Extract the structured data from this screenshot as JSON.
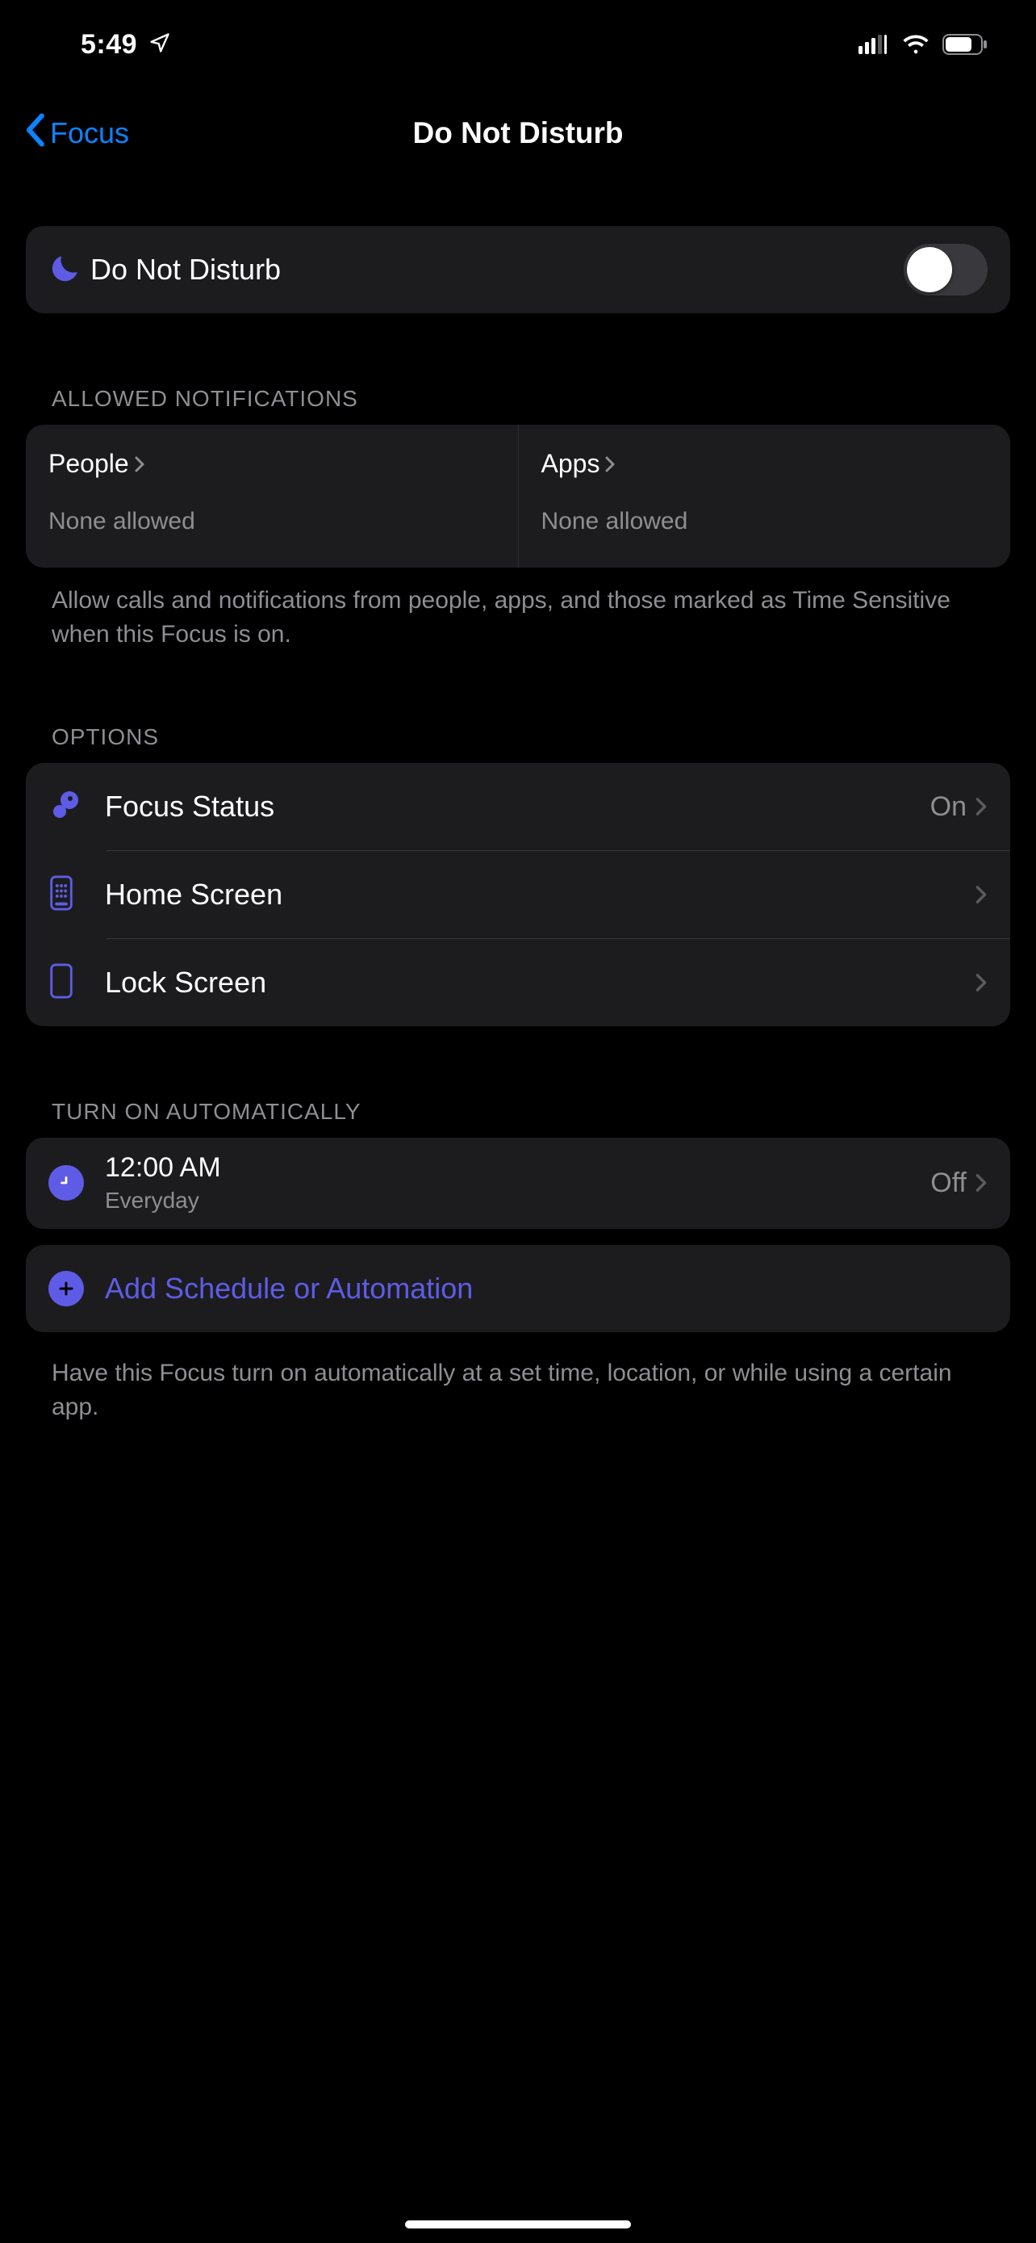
{
  "status": {
    "time": "5:49"
  },
  "nav": {
    "back_label": "Focus",
    "title": "Do Not Disturb"
  },
  "dnd_toggle": {
    "label": "Do Not Disturb"
  },
  "allowed": {
    "header": "ALLOWED NOTIFICATIONS",
    "people_label": "People",
    "people_sub": "None allowed",
    "apps_label": "Apps",
    "apps_sub": "None allowed",
    "footer": "Allow calls and notifications from people, apps, and those marked as Time Sensitive when this Focus is on."
  },
  "options": {
    "header": "OPTIONS",
    "focus_status_label": "Focus Status",
    "focus_status_value": "On",
    "home_screen_label": "Home Screen",
    "lock_screen_label": "Lock Screen"
  },
  "auto": {
    "header": "TURN ON AUTOMATICALLY",
    "schedule_time": "12:00 AM",
    "schedule_repeat": "Everyday",
    "schedule_value": "Off",
    "add_label": "Add Schedule or Automation",
    "footer": "Have this Focus turn on automatically at a set time, location, or while using a certain app."
  },
  "colors": {
    "accent": "#5e5ce6",
    "link": "#0a84ff"
  }
}
